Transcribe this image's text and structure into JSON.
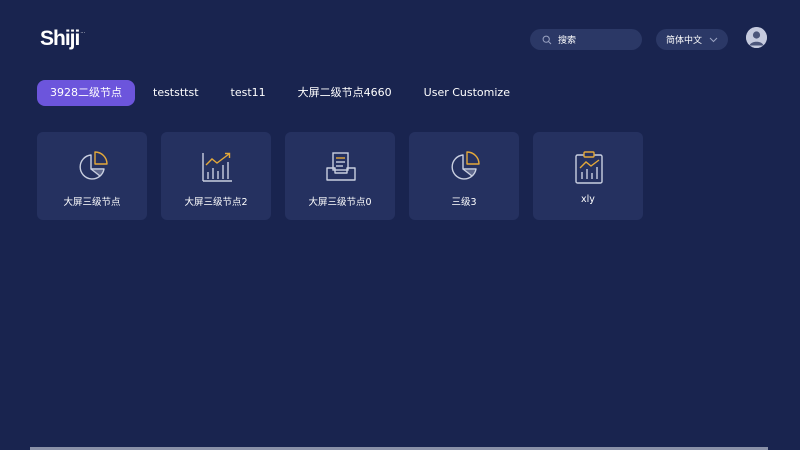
{
  "brand": {
    "logo_text": "Shiji",
    "logo_dots": "···"
  },
  "header": {
    "search_placeholder": "搜索",
    "language": "简体中文"
  },
  "tabs": [
    {
      "label": "3928二级节点",
      "active": true
    },
    {
      "label": "teststtst",
      "active": false
    },
    {
      "label": "test11",
      "active": false
    },
    {
      "label": "大屏二级节点4660",
      "active": false
    },
    {
      "label": "User Customize",
      "active": false
    }
  ],
  "cards": [
    {
      "label": "大屏三级节点",
      "icon": "pie-chart-icon"
    },
    {
      "label": "大屏三级节点2",
      "icon": "bar-trend-chart-icon"
    },
    {
      "label": "大屏三级节点0",
      "icon": "inbox-tray-icon"
    },
    {
      "label": "三级3",
      "icon": "pie-chart-icon"
    },
    {
      "label": "xly",
      "icon": "clipboard-chart-icon"
    }
  ],
  "colors": {
    "background": "#19244f",
    "card": "#253160",
    "accent": "#6c55dc",
    "icon_stroke": "#c9cfe0",
    "icon_highlight": "#e3a83a"
  }
}
